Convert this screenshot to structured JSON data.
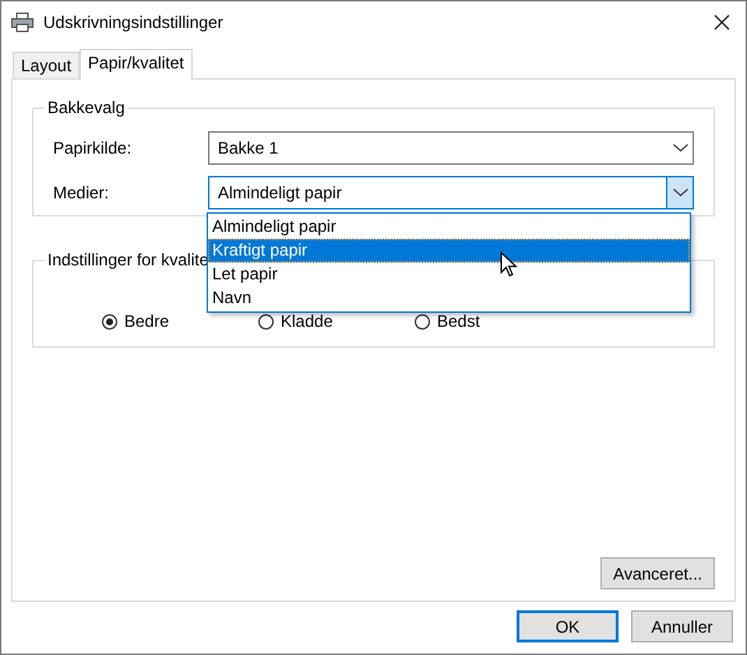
{
  "window": {
    "title": "Udskrivningsindstillinger"
  },
  "tabs": [
    {
      "label": "Layout",
      "selected": false
    },
    {
      "label": "Papir/kvalitet",
      "selected": true
    }
  ],
  "tray_group": {
    "title": "Bakkevalg",
    "fields": [
      {
        "label": "Papirkilde:",
        "value": "Bakke 1",
        "open": false
      },
      {
        "label": "Medier:",
        "value": "Almindeligt papir",
        "open": true,
        "options": [
          {
            "label": "Almindeligt papir",
            "highlighted": false
          },
          {
            "label": "Kraftigt papir",
            "highlighted": true
          },
          {
            "label": "Let papir",
            "highlighted": false
          },
          {
            "label": "Navn",
            "highlighted": false
          }
        ]
      }
    ]
  },
  "quality_group": {
    "title": "Indstillinger for kvalite",
    "options": [
      {
        "label": "Bedre",
        "selected": true
      },
      {
        "label": "Kladde",
        "selected": false
      },
      {
        "label": "Bedst",
        "selected": false
      }
    ]
  },
  "advanced_button": "Avanceret...",
  "buttons": [
    {
      "label": "OK",
      "default": true
    },
    {
      "label": "Annuller",
      "default": false
    }
  ]
}
